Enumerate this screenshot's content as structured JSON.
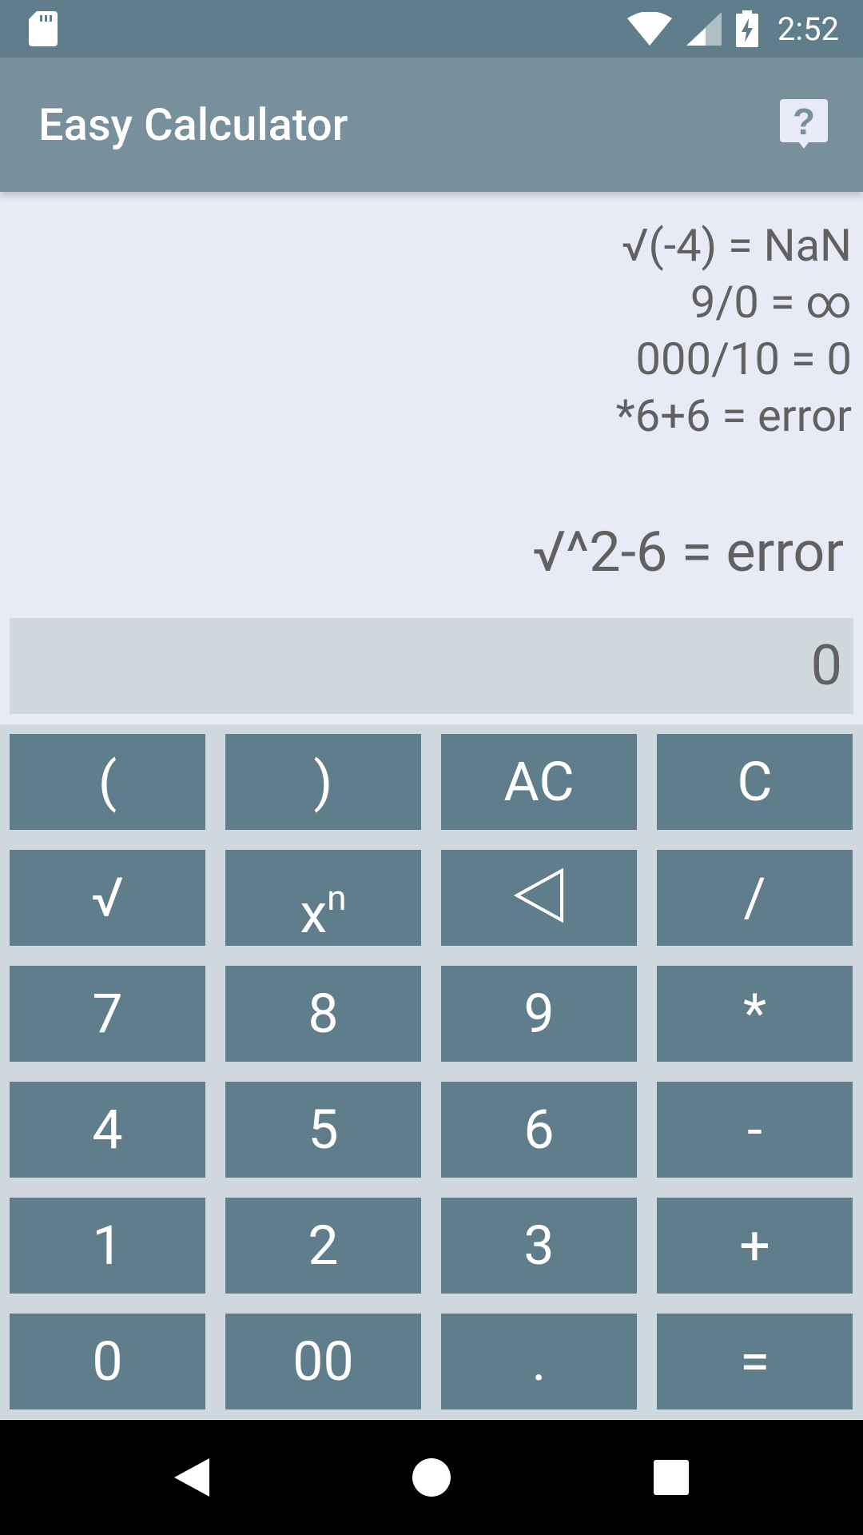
{
  "status_bar": {
    "time": "2:52",
    "icons": [
      "sd-card-icon",
      "wifi-icon",
      "cell-signal-icon",
      "battery-charging-icon"
    ]
  },
  "app_bar": {
    "title": "Easy Calculator",
    "help_icon": "help-icon"
  },
  "history": [
    "√(-4) = NaN",
    "9/0 = ∞",
    "000/10 = 0",
    "*6+6 = error"
  ],
  "expression": "√^2-6 = error",
  "result": "0",
  "keypad": {
    "rows": [
      [
        "(",
        ")",
        "AC",
        "C"
      ],
      [
        "√",
        "xn",
        "◁",
        "/"
      ],
      [
        "7",
        "8",
        "9",
        "*"
      ],
      [
        "4",
        "5",
        "6",
        "-"
      ],
      [
        "1",
        "2",
        "3",
        "+"
      ],
      [
        "0",
        "00",
        ".",
        "="
      ]
    ],
    "power_base": "x",
    "power_exp": "n"
  },
  "colors": {
    "status_bar": "#607d8b",
    "app_bar": "#78909c",
    "key": "#607d8b",
    "keypad_bg": "#cfd8dc",
    "display_bg": "#e8eaf6"
  },
  "nav_bar": {
    "back": "back-icon",
    "home": "home-icon",
    "recents": "recents-icon"
  }
}
